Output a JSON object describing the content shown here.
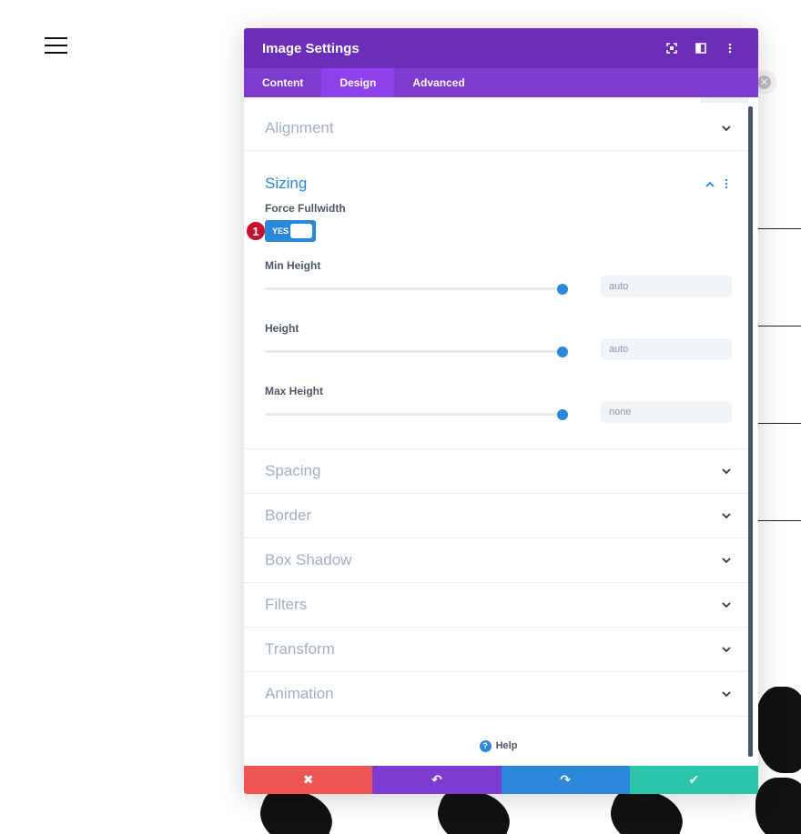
{
  "colors": {
    "header_bg": "#6c2eb9",
    "tabs_bg": "#7e3bd0",
    "tab_active_bg": "#8f42ec",
    "accent_blue": "#2b87da",
    "cancel_red": "#ef5555",
    "undo_purple": "#7e3bd0",
    "redo_blue": "#2b87da",
    "save_green": "#29c4a9",
    "badge_red": "#c8102e"
  },
  "modal": {
    "title": "Image Settings",
    "header_icons": [
      "expand-icon",
      "sidebar-layout-icon",
      "more-vertical-icon"
    ]
  },
  "tabs": [
    {
      "label": "Content",
      "active": false
    },
    {
      "label": "Design",
      "active": true
    },
    {
      "label": "Advanced",
      "active": false
    }
  ],
  "sections": {
    "alignment": "Alignment",
    "sizing": "Sizing",
    "spacing": "Spacing",
    "border": "Border",
    "box_shadow": "Box Shadow",
    "filters": "Filters",
    "transform": "Transform",
    "animation": "Animation"
  },
  "sizing": {
    "force_fullwidth": {
      "label": "Force Fullwidth",
      "toggle": "YES",
      "badge": "1"
    },
    "min_height": {
      "label": "Min Height",
      "value": "auto",
      "slider_level": 1.0
    },
    "height": {
      "label": "Height",
      "value": "auto",
      "slider_level": 1.0
    },
    "max_height": {
      "label": "Max Height",
      "value": "none",
      "slider_level": 1.0
    }
  },
  "help": {
    "label": "Help",
    "icon": "?"
  },
  "footer": {
    "cancel": "✖",
    "undo": "↶",
    "redo": "↷",
    "save": "✔"
  }
}
